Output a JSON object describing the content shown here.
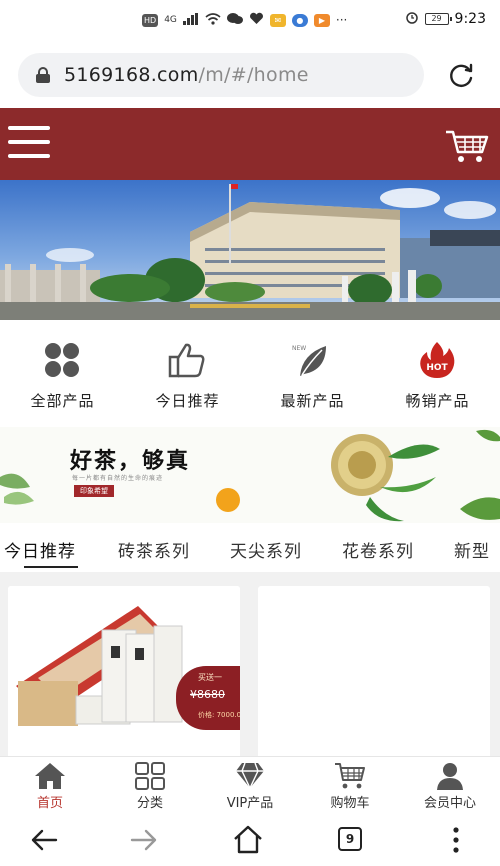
{
  "status_bar": {
    "left_label": "HD",
    "signal": "4G",
    "battery": "29",
    "time": "9:23"
  },
  "address_bar": {
    "url_domain": "5169168.com",
    "url_path": "/m/#/home"
  },
  "categories": [
    {
      "label": "全部产品",
      "icon": "grid-icon"
    },
    {
      "label": "今日推荐",
      "icon": "thumbs-up-icon"
    },
    {
      "label": "最新产品",
      "icon": "leaf-new-icon"
    },
    {
      "label": "畅销产品",
      "icon": "hot-flame-icon"
    }
  ],
  "hot_badge": "HOT",
  "new_badge": "NEW",
  "promo": {
    "title": "好茶，够真",
    "subtitle": "每一片都有自然的生命的痕迹",
    "badge": "印象希望"
  },
  "tabs": [
    "今日推荐",
    "砖茶系列",
    "天尖系列",
    "花卷系列",
    "新型"
  ],
  "product": {
    "tag_top": "买送一",
    "price_old": "¥8680",
    "price_new": "价格: 7000.00"
  },
  "bottom_nav": [
    {
      "label": "首页",
      "icon": "home-icon",
      "active": true
    },
    {
      "label": "分类",
      "icon": "category-icon",
      "active": false
    },
    {
      "label": "VIP产品",
      "icon": "vip-diamond-icon",
      "active": false
    },
    {
      "label": "购物车",
      "icon": "cart-icon",
      "active": false
    },
    {
      "label": "会员中心",
      "icon": "member-icon",
      "active": false
    }
  ],
  "system_nav": {
    "tab_count": "9"
  },
  "colors": {
    "brand": "#8c2a2b",
    "active_nav": "#b7362f"
  }
}
